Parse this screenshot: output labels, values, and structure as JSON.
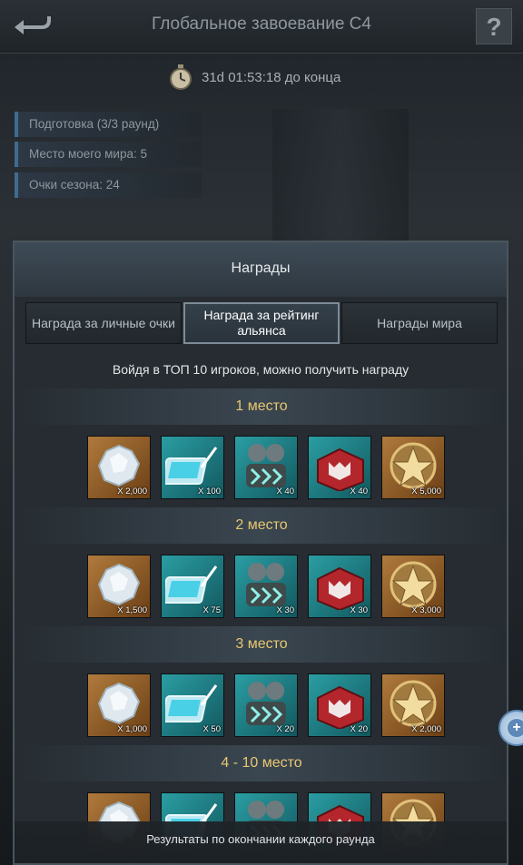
{
  "header": {
    "title": "Глобальное завоевание С4",
    "back_icon": "back-arrow-icon",
    "help_label": "?"
  },
  "timer": {
    "text": "31d 01:53:18 до конца",
    "icon": "stopwatch-icon"
  },
  "info": [
    "Подготовка  (3/3 раунд)",
    "Место моего мира: 5",
    "Очки сезона: 24"
  ],
  "panel": {
    "title": "Награды",
    "tabs": [
      {
        "label": "Награда за личные очки",
        "active": false
      },
      {
        "label": "Награда за рейтинг альянса",
        "active": true
      },
      {
        "label": "Награды мира",
        "active": false
      }
    ],
    "description": "Войдя в ТОП 10 игроков, можно получить награду",
    "places": [
      {
        "label": "1 место",
        "quantities": [
          "X 2,000",
          "X 100",
          "X 40",
          "X 40",
          "X 5,000"
        ]
      },
      {
        "label": "2 место",
        "quantities": [
          "X 1,500",
          "X 75",
          "X 30",
          "X 30",
          "X 3,000"
        ]
      },
      {
        "label": "3 место",
        "quantities": [
          "X 1,000",
          "X 50",
          "X 20",
          "X 20",
          "X 2,000"
        ]
      },
      {
        "label": "4 - 10 место",
        "quantities": [
          "",
          "",
          "",
          "",
          ""
        ]
      }
    ],
    "item_icons": [
      "crystal-ore-icon",
      "tablet-icon",
      "soldiers-icon",
      "red-crate-icon",
      "gold-star-medal-icon"
    ],
    "footer": "Результаты по окончании каждого раунда"
  },
  "colors": {
    "accent_gold": "#e8c770",
    "panel_bg": "#262c31",
    "tab_active_border": "#7e8c97"
  }
}
